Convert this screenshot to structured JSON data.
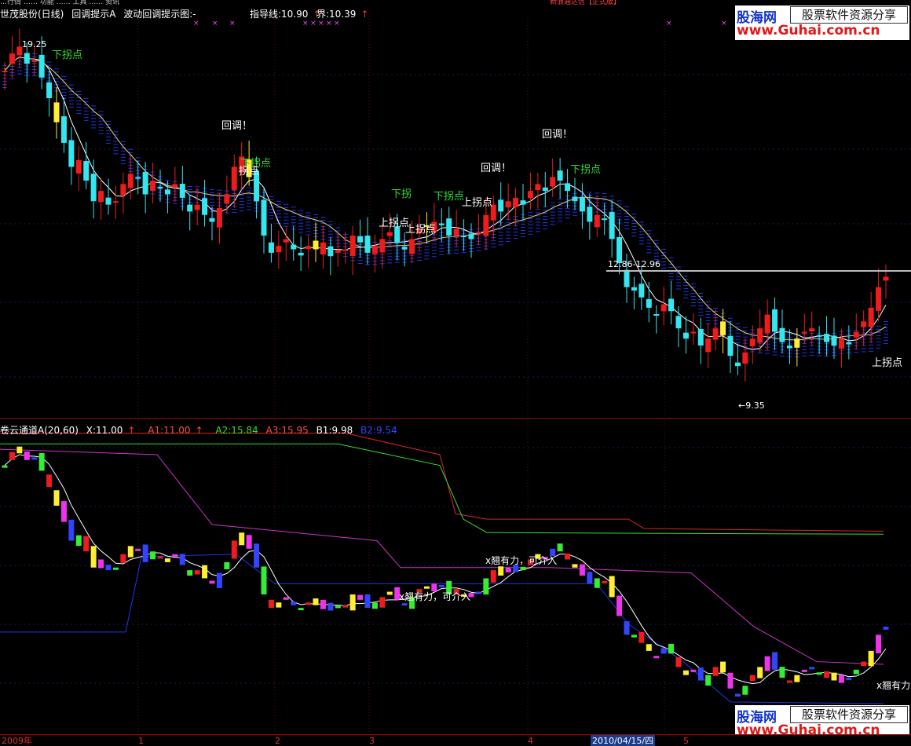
{
  "menu_strip": "…行情  …… 功能  …… 工具  …… 资讯",
  "top_right_link": "新浪通达信【正式版】",
  "upper_panel": {
    "title": "世茂股份(日线)",
    "indicator_name": "回调提示A",
    "indicator_name2": "波动回调提示图:-",
    "guide_label": "指导线:10.90",
    "boundary_label": "界:10.39",
    "up_arrow": "↑",
    "annotations": [
      {
        "text": "19.25",
        "kind": "price"
      },
      {
        "text": "下拐点",
        "kind": "green"
      },
      {
        "text": "回调！",
        "kind": "white"
      },
      {
        "text": "下拐点",
        "kind": "green"
      },
      {
        "text": "拐点",
        "kind": "white"
      },
      {
        "text": "下拐",
        "kind": "green"
      },
      {
        "text": "上拐点",
        "kind": "white"
      },
      {
        "text": "下拐点",
        "kind": "green"
      },
      {
        "text": "上拐点",
        "kind": "white"
      },
      {
        "text": "上拐点",
        "kind": "white"
      },
      {
        "text": "回调！",
        "kind": "white"
      },
      {
        "text": "回调！",
        "kind": "white"
      },
      {
        "text": "下拐点",
        "kind": "green"
      },
      {
        "text": "12.86-12.96",
        "kind": "price"
      },
      {
        "text": "←9.35",
        "kind": "price"
      },
      {
        "text": "上拐点",
        "kind": "white"
      }
    ]
  },
  "lower_panel": {
    "title": "卷云通道A(20,60)",
    "x_label": "X:11.00",
    "a1_label": "A1:11.00",
    "a2_label": "A2:15.84",
    "a3_label": "A3:15.95",
    "b1_label": "B1:9.98",
    "b2_label": "B2:9.54",
    "colors": {
      "x": "#ffffff",
      "a1": "#ff3b3b",
      "a2": "#33dd33",
      "a3": "#ff3b3b",
      "b1": "#ffffff",
      "b2": "#3344ff"
    },
    "annotations": [
      {
        "text": "x翘有力，可介入"
      },
      {
        "text": "x翘有力，可介入"
      },
      {
        "text": "x翘有力"
      }
    ]
  },
  "date_axis": {
    "labels": [
      "2009年",
      "1",
      "2",
      "3",
      "4",
      "2010/04/15/四",
      "5"
    ]
  },
  "watermark": {
    "name": "股海网",
    "tagline": "股票软件资源分享",
    "url": "www.Guhai.com.cn"
  },
  "chart_data": [
    {
      "type": "candlestick",
      "title": "世茂股份(日线) 回调提示A 波动回调提示图",
      "ylim": [
        9.0,
        20.0
      ],
      "price_labels": {
        "high": 19.25,
        "low": 9.35,
        "range_label": "12.86-12.96"
      },
      "guide_line": 10.9,
      "boundary_line": 10.39,
      "close_series": [
        18.4,
        18.9,
        19.1,
        18.6,
        18.7,
        18.2,
        17.6,
        16.9,
        16.3,
        15.6,
        15.8,
        15.2,
        14.6,
        14.9,
        14.5,
        14.6,
        15.1,
        15.4,
        15.3,
        14.8,
        15.2,
        15.0,
        14.8,
        15.1,
        14.7,
        14.3,
        14.5,
        14.2,
        14.0,
        14.4,
        14.8,
        15.6,
        15.9,
        15.3,
        14.6,
        13.6,
        13.1,
        13.3,
        13.4,
        13.2,
        13.1,
        13.3,
        13.2,
        13.4,
        13.0,
        13.1,
        13.2,
        13.6,
        13.4,
        13.1,
        13.3,
        13.5,
        13.7,
        13.4,
        13.2,
        13.5,
        13.8,
        13.9,
        14.0,
        13.9,
        13.6,
        13.8,
        13.6,
        13.5,
        13.7,
        14.2,
        14.5,
        14.3,
        14.6,
        14.7,
        14.5,
        14.9,
        15.1,
        15.0,
        15.3,
        15.2,
        14.9,
        14.6,
        14.3,
        14.0,
        14.2,
        14.1,
        13.5,
        12.8,
        12.1,
        12.0,
        11.8,
        11.5,
        11.3,
        11.6,
        11.4,
        10.9,
        10.6,
        10.8,
        10.4,
        10.6,
        10.9,
        10.7,
        10.1,
        9.8,
        10.2,
        10.6,
        10.9,
        11.3,
        10.8,
        10.5,
        10.4,
        10.6,
        10.8,
        10.9,
        10.7,
        10.5,
        10.4,
        10.6,
        10.5,
        10.8,
        11.1,
        11.5,
        12.1,
        12.4
      ]
    },
    {
      "type": "candlestick",
      "title": "卷云通道A(20,60)",
      "series": [
        {
          "name": "X",
          "last": 11.0
        },
        {
          "name": "A1",
          "last": 11.0
        },
        {
          "name": "A2",
          "last": 15.84
        },
        {
          "name": "A3",
          "last": 15.95
        },
        {
          "name": "B1",
          "last": 9.98
        },
        {
          "name": "B2",
          "last": 9.54
        }
      ]
    }
  ]
}
